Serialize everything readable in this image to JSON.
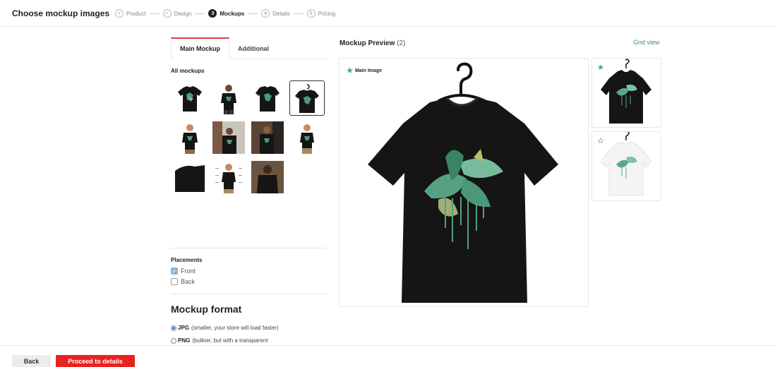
{
  "header": {
    "title": "Choose mockup images",
    "steps": [
      {
        "badge": "✓",
        "label": "Product"
      },
      {
        "badge": "✓",
        "label": "Design"
      },
      {
        "badge": "3",
        "label": "Mockups"
      },
      {
        "badge": "4",
        "label": "Details"
      },
      {
        "badge": "5",
        "label": "Pricing"
      }
    ]
  },
  "left": {
    "tabs": [
      "Main Mockup",
      "Additional"
    ],
    "all_mockups_label": "All mockups",
    "placements": {
      "title": "Placements",
      "options": [
        {
          "label": "Front",
          "checked": true
        },
        {
          "label": "Back",
          "checked": false
        }
      ]
    },
    "format": {
      "title": "Mockup format",
      "options": [
        {
          "name": "JPG",
          "desc": "(smaller, your store will load faster)",
          "selected": true
        },
        {
          "name": "PNG",
          "desc": "(bulkier, but with a transparent",
          "selected": false
        }
      ]
    }
  },
  "preview": {
    "title": "Mockup Preview",
    "count": "(2)",
    "grid_view": "Grid view",
    "main_image_label": "Main Image",
    "star_filled": "★",
    "star_empty": "☆"
  },
  "footer": {
    "back": "Back",
    "proceed": "Proceed to details"
  },
  "colors": {
    "accent_red": "#e8221f",
    "teal": "#2ea8a0",
    "shirt_black": "#151515"
  }
}
